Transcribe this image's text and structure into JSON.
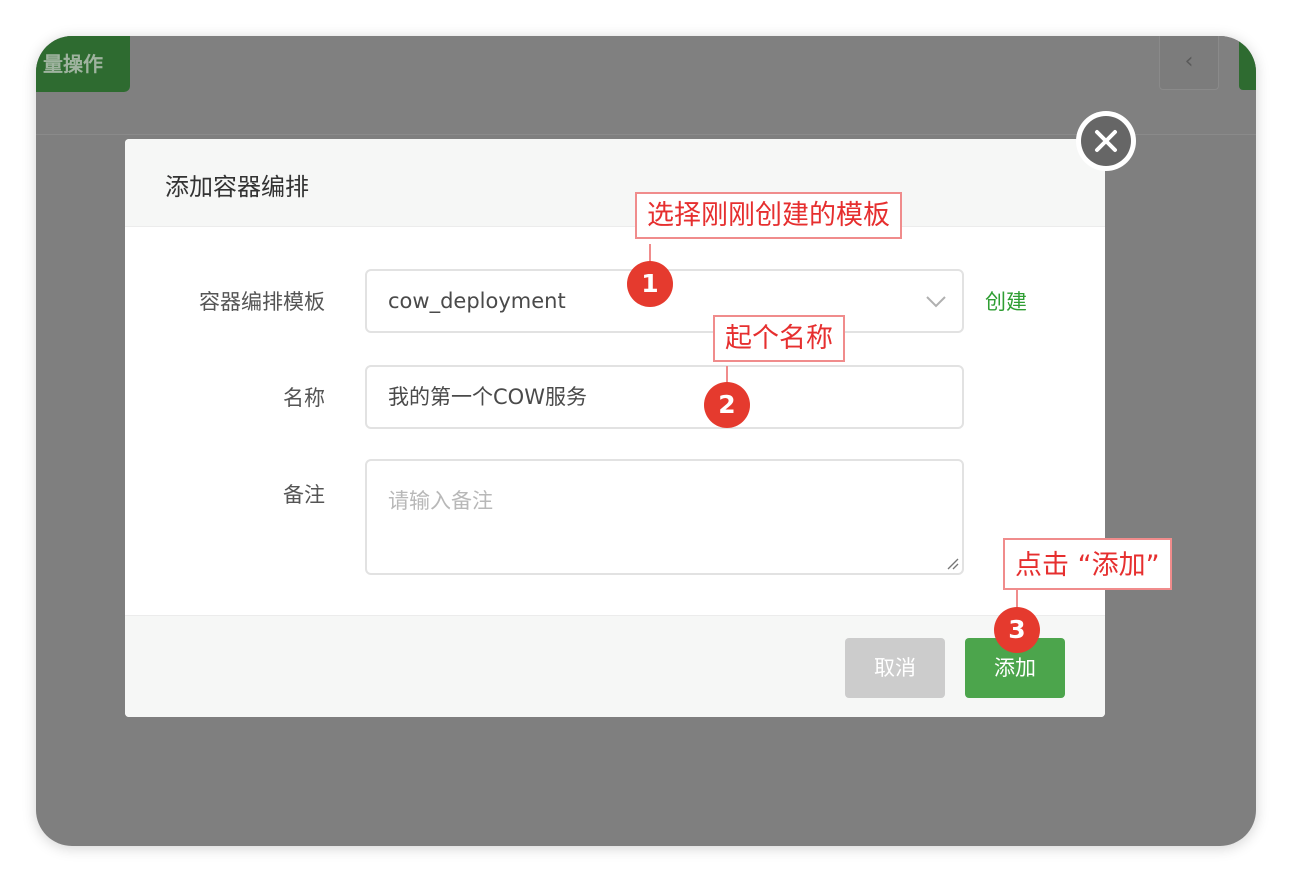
{
  "background": {
    "bulk_action_label": "量操作",
    "nav_prev_glyph": "‹"
  },
  "dialog": {
    "title": "添加容器编排",
    "template_label": "容器编排模板",
    "template_value": "cow_deployment",
    "create_link": "创建",
    "name_label": "名称",
    "name_value": "我的第一个COW服务",
    "note_label": "备注",
    "note_placeholder": "请输入备注",
    "cancel_label": "取消",
    "add_label": "添加"
  },
  "annotations": [
    {
      "number": "1",
      "text": "选择刚刚创建的模板"
    },
    {
      "number": "2",
      "text": "起个名称"
    },
    {
      "number": "3",
      "text": "点击 “添加”"
    }
  ],
  "colors": {
    "overlay": "#7f7f7f",
    "primary_green": "#4ca54c",
    "link_green": "#2f9e33",
    "annotation_red": "#e53a2e"
  },
  "icons": {
    "close": "close-circle-icon",
    "select": "chevron-down-icon",
    "resize": "resize-grip-icon"
  }
}
